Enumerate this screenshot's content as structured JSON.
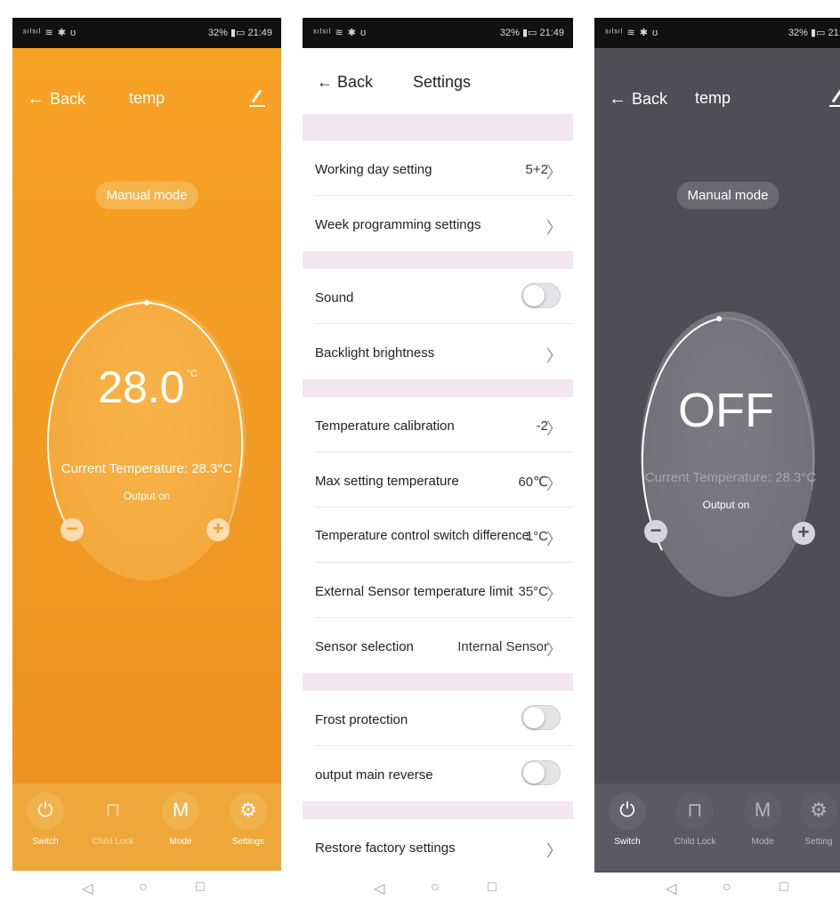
{
  "status": {
    "signal": "ⁿ𝗅ⁿ𝗅⇡ℹ",
    "left_text": "ⁿᵢₗⁿᵢₗ ♨ ✻ ʘ",
    "battery": "32%",
    "time": "21:49"
  },
  "screen1": {
    "back_label": "Back",
    "title": "temp",
    "mode": "Manual mode",
    "set_temp": "28.0",
    "unit": "°C",
    "current_temp": "Current Temperature: 28.3°C",
    "output": "Output on",
    "tabs": [
      {
        "label": "Switch",
        "glyph": "⏻"
      },
      {
        "label": "Child Lock",
        "glyph": "⊓"
      },
      {
        "label": "Mode",
        "glyph": "M"
      },
      {
        "label": "Settings",
        "glyph": "⚙"
      }
    ]
  },
  "screen2": {
    "back_label": "Back",
    "title": "Settings",
    "rows": [
      {
        "label": "Working day setting",
        "value": "5+2"
      },
      {
        "label": "Week programming settings",
        "value": ""
      },
      {
        "label": "Sound",
        "value": ""
      },
      {
        "label": "Backlight brightness",
        "value": ""
      },
      {
        "label": "Temperature calibration",
        "value": "-2"
      },
      {
        "label": "Max setting temperature",
        "value": "60℃"
      },
      {
        "label": "Temperature control switch difference",
        "value": "1°C"
      },
      {
        "label": "External Sensor temperature limit",
        "value": "35°C"
      },
      {
        "label": "Sensor selection",
        "value": "Internal Sensor"
      },
      {
        "label": "Frost protection",
        "value": ""
      },
      {
        "label": "output main reverse",
        "value": ""
      },
      {
        "label": "Restore factory settings",
        "value": ""
      }
    ],
    "toggles": {
      "sound": false,
      "frost_protection": false,
      "output_main_reverse": false
    }
  },
  "screen3": {
    "back_label": "Back",
    "title": "temp",
    "mode": "Manual mode",
    "set_temp": "OFF",
    "current_temp": "Current Temperature: 28.3°C",
    "output": "Output on",
    "tabs": [
      {
        "label": "Switch",
        "glyph": "⏻"
      },
      {
        "label": "Child Lock",
        "glyph": "⊓"
      },
      {
        "label": "Mode",
        "glyph": "M"
      },
      {
        "label": "Setting",
        "glyph": "⚙"
      }
    ]
  },
  "nav": {
    "back": "◁",
    "home": "○",
    "recent": "□"
  },
  "colors": {
    "orange": "#f19a25",
    "dark": "#4f4e54",
    "divider": "#f2e7ee"
  }
}
